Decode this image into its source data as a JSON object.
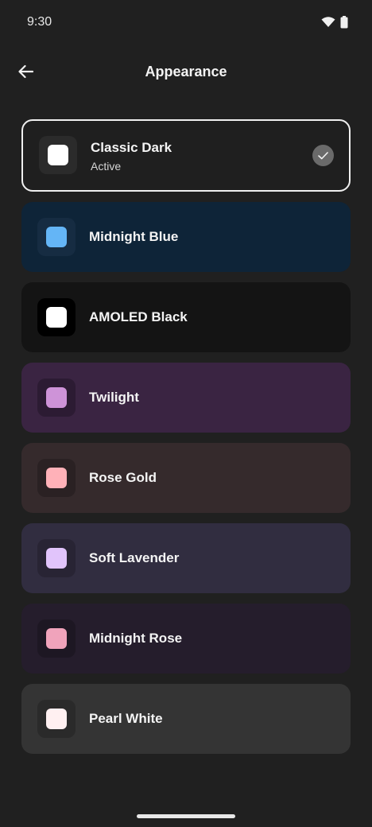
{
  "status_bar": {
    "time": "9:30"
  },
  "app_bar": {
    "title": "Appearance"
  },
  "themes": [
    {
      "name": "Classic Dark",
      "subtitle": "Active",
      "active": true,
      "card_bg": "#1f1f1f",
      "icon_bg": "#2b2b2b",
      "swatch": "#ffffff"
    },
    {
      "name": "Midnight Blue",
      "card_bg": "#0e2438",
      "icon_bg": "#162c42",
      "swatch": "#64b5f6"
    },
    {
      "name": "AMOLED Black",
      "card_bg": "#141414",
      "icon_bg": "#000000",
      "swatch": "#ffffff"
    },
    {
      "name": "Twilight",
      "card_bg": "#3a2442",
      "icon_bg": "#2c1b33",
      "swatch": "#ce93d8"
    },
    {
      "name": "Rose Gold",
      "card_bg": "#352a2c",
      "icon_bg": "#2a2123",
      "swatch": "#ffb1b8"
    },
    {
      "name": "Soft Lavender",
      "card_bg": "#312d40",
      "icon_bg": "#282434",
      "swatch": "#e1c4fb"
    },
    {
      "name": "Midnight Rose",
      "card_bg": "#251d2c",
      "icon_bg": "#1d1723",
      "swatch": "#f0a3bb"
    },
    {
      "name": "Pearl White",
      "card_bg": "#343434",
      "icon_bg": "#2a2a2a",
      "swatch": "#fff0f1"
    }
  ]
}
